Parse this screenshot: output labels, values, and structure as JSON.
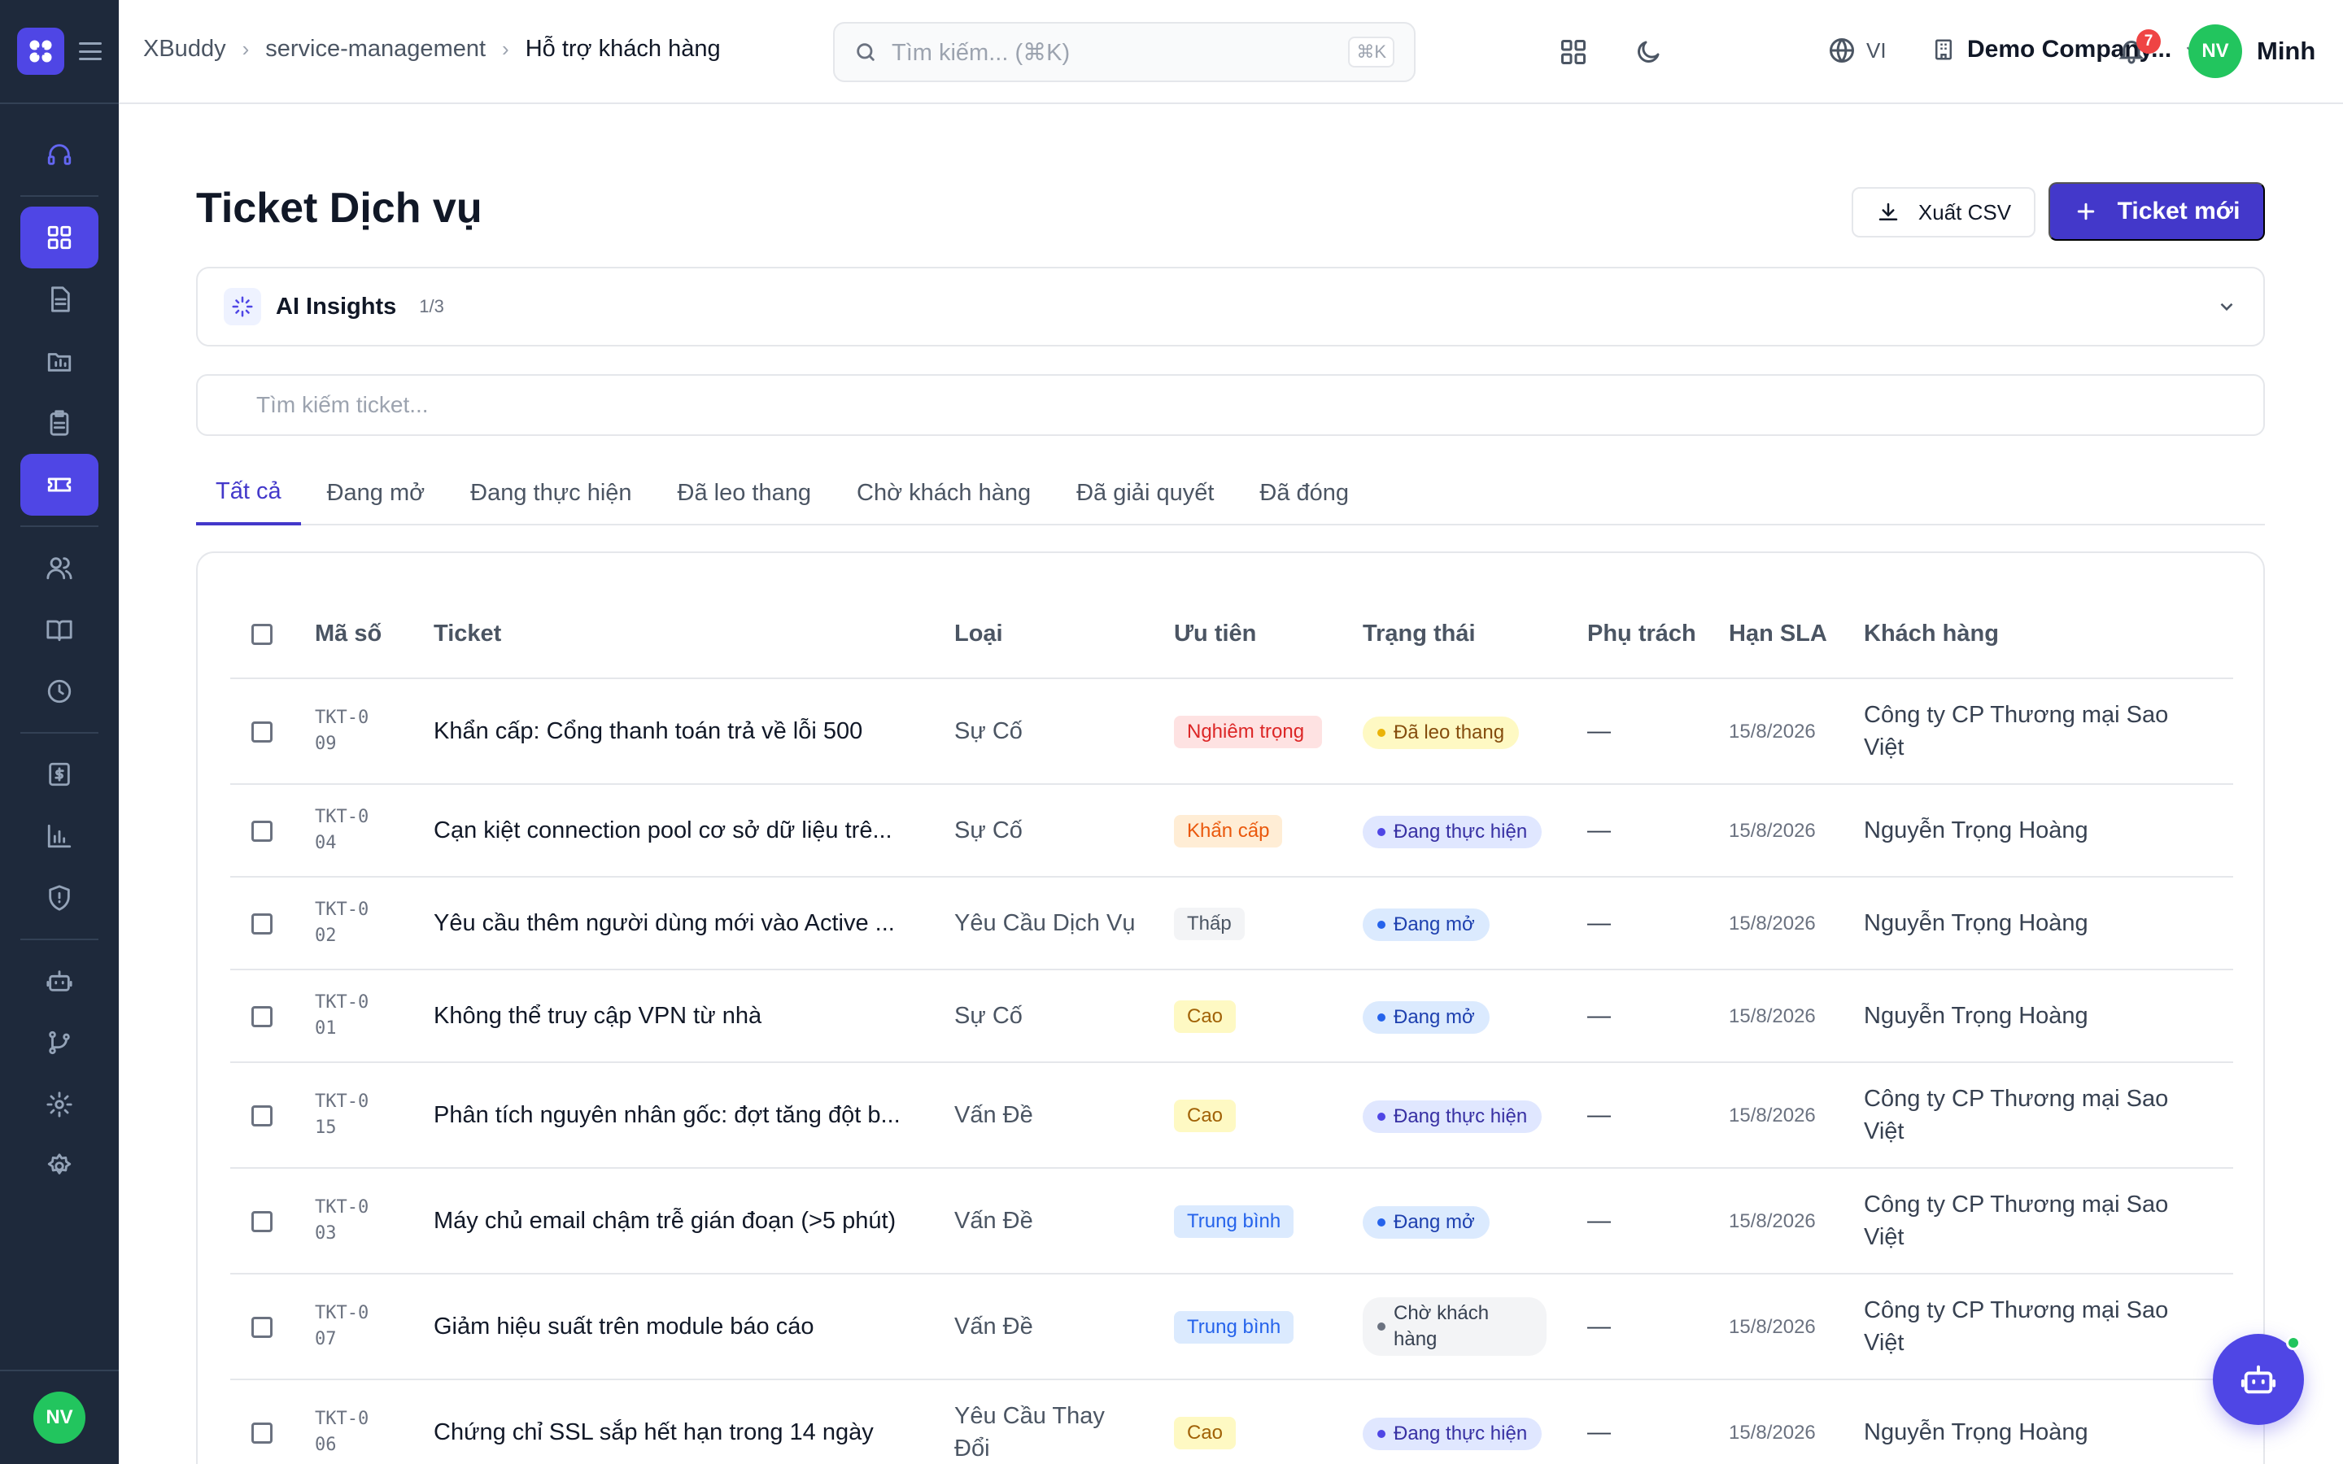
{
  "header": {
    "breadcrumb": [
      "XBuddy",
      "service-management",
      "Hỗ trợ khách hàng"
    ],
    "search_placeholder": "Tìm kiếm... (⌘K)",
    "search_shortcut": "⌘K",
    "language": "VI",
    "company": "Demo Company...",
    "notification_count": "7",
    "user_initials": "NV",
    "user_name": "Minh"
  },
  "sidebar": {
    "icons": [
      "headset-icon",
      "dashboard-icon",
      "document-icon",
      "folder-icon",
      "clipboard-icon",
      "ticket-icon",
      "users-icon",
      "book-icon",
      "clock-icon",
      "invoice-icon",
      "chart-icon",
      "shield-icon",
      "bot-icon",
      "git-branch-icon",
      "gear-icon",
      "settings-icon"
    ],
    "active_index": 5,
    "user_initials": "NV"
  },
  "page": {
    "title": "Ticket Dịch vụ",
    "export_label": "Xuất CSV",
    "new_label": "Ticket mới"
  },
  "ai_insights": {
    "title": "AI Insights",
    "count": "1/3"
  },
  "ticket_search": {
    "placeholder": "Tìm kiếm ticket..."
  },
  "tabs": [
    "Tất cả",
    "Đang mở",
    "Đang thực hiện",
    "Đã leo thang",
    "Chờ khách hàng",
    "Đã giải quyết",
    "Đã đóng"
  ],
  "table": {
    "headers": {
      "code": "Mã số",
      "ticket": "Ticket",
      "type": "Loại",
      "priority": "Ưu tiên",
      "status": "Trạng thái",
      "assignee": "Phụ trách",
      "sla": "Hạn SLA",
      "customer": "Khách hàng"
    },
    "rows": [
      {
        "code": "TKT-009",
        "title": "Khẩn cấp: Cổng thanh toán trả về lỗi 500",
        "type": "Sự Cố",
        "priority": "Nghiêm trọng",
        "priority_kind": "critical",
        "status": "Đã leo thang",
        "status_kind": "esc",
        "assignee": "—",
        "sla": "15/8/2026",
        "customer": "Công ty CP Thương mại Sao Việt"
      },
      {
        "code": "TKT-004",
        "title": "Cạn kiệt connection pool cơ sở dữ liệu trê...",
        "type": "Sự Cố",
        "priority": "Khẩn cấp",
        "priority_kind": "urgent",
        "status": "Đang thực hiện",
        "status_kind": "prog",
        "assignee": "—",
        "sla": "15/8/2026",
        "customer": "Nguyễn Trọng Hoàng"
      },
      {
        "code": "TKT-002",
        "title": "Yêu cầu thêm người dùng mới vào Active ...",
        "type": "Yêu Cầu Dịch Vụ",
        "priority": "Thấp",
        "priority_kind": "low",
        "status": "Đang mở",
        "status_kind": "open",
        "assignee": "—",
        "sla": "15/8/2026",
        "customer": "Nguyễn Trọng Hoàng"
      },
      {
        "code": "TKT-001",
        "title": "Không thể truy cập VPN từ nhà",
        "type": "Sự Cố",
        "priority": "Cao",
        "priority_kind": "high",
        "status": "Đang mở",
        "status_kind": "open",
        "assignee": "—",
        "sla": "15/8/2026",
        "customer": "Nguyễn Trọng Hoàng"
      },
      {
        "code": "TKT-015",
        "title": "Phân tích nguyên nhân gốc: đợt tăng đột b...",
        "type": "Vấn Đề",
        "priority": "Cao",
        "priority_kind": "high",
        "status": "Đang thực hiện",
        "status_kind": "prog",
        "assignee": "—",
        "sla": "15/8/2026",
        "customer": "Công ty CP Thương mại Sao Việt"
      },
      {
        "code": "TKT-003",
        "title": "Máy chủ email chậm trễ gián đoạn (>5 phút)",
        "type": "Vấn Đề",
        "priority": "Trung bình",
        "priority_kind": "medium",
        "status": "Đang mở",
        "status_kind": "open",
        "assignee": "—",
        "sla": "15/8/2026",
        "customer": "Công ty CP Thương mại Sao Việt"
      },
      {
        "code": "TKT-007",
        "title": "Giảm hiệu suất trên module báo cáo",
        "type": "Vấn Đề",
        "priority": "Trung bình",
        "priority_kind": "medium",
        "status": "Chờ khách hàng",
        "status_kind": "wait",
        "assignee": "—",
        "sla": "15/8/2026",
        "customer": "Công ty CP Thương mại Sao Việt"
      },
      {
        "code": "TKT-006",
        "title": "Chứng chỉ SSL sắp hết hạn trong 14 ngày",
        "type": "Yêu Cầu Thay Đổi",
        "priority": "Cao",
        "priority_kind": "high",
        "status": "Đang thực hiện",
        "status_kind": "prog",
        "assignee": "—",
        "sla": "15/8/2026",
        "customer": "Nguyễn Trọng Hoàng"
      }
    ]
  },
  "colors": {
    "accent": "#4f46e5",
    "sidebar": "#1e293b",
    "avatar": "#22c55e"
  }
}
